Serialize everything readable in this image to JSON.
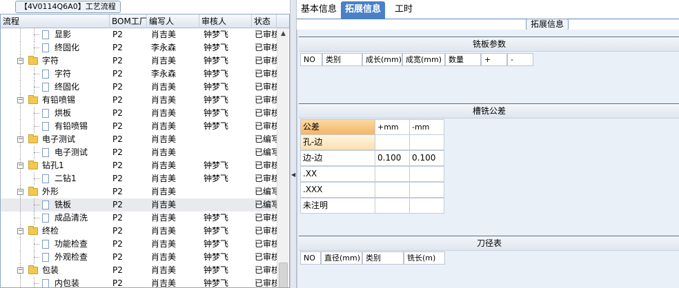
{
  "left_panel": {
    "title": "【4V0114Q6A0】工艺流程",
    "columns": [
      "流程",
      "BOM工厂",
      "编写人",
      "审核人",
      "状态"
    ],
    "rows": [
      {
        "name": "显影",
        "level": 1,
        "kind": "doc",
        "bom": "P2",
        "writer": "肖吉美",
        "reviewer": "钟梦飞",
        "status": "已审核"
      },
      {
        "name": "终固化",
        "level": 1,
        "kind": "doc",
        "bom": "P2",
        "writer": "李永森",
        "reviewer": "钟梦飞",
        "status": "已审核"
      },
      {
        "name": "字符",
        "level": 0,
        "kind": "folder",
        "bom": "P2",
        "writer": "肖吉美",
        "reviewer": "钟梦飞",
        "status": "已审核"
      },
      {
        "name": "字符",
        "level": 1,
        "kind": "doc",
        "bom": "P2",
        "writer": "李永森",
        "reviewer": "钟梦飞",
        "status": "已审核"
      },
      {
        "name": "终固化",
        "level": 1,
        "kind": "doc",
        "bom": "P2",
        "writer": "肖吉美",
        "reviewer": "钟梦飞",
        "status": "已审核"
      },
      {
        "name": "有铅喷锡",
        "level": 0,
        "kind": "folder",
        "bom": "P2",
        "writer": "肖吉美",
        "reviewer": "钟梦飞",
        "status": "已审核"
      },
      {
        "name": "烘板",
        "level": 1,
        "kind": "doc",
        "bom": "P2",
        "writer": "肖吉美",
        "reviewer": "钟梦飞",
        "status": "已审核"
      },
      {
        "name": "有铅喷锡",
        "level": 1,
        "kind": "doc",
        "bom": "P2",
        "writer": "肖吉美",
        "reviewer": "钟梦飞",
        "status": "已审核"
      },
      {
        "name": "电子测试",
        "level": 0,
        "kind": "folder",
        "bom": "P2",
        "writer": "肖吉美",
        "reviewer": "",
        "status": "已编写"
      },
      {
        "name": "电子测试",
        "level": 1,
        "kind": "doc",
        "bom": "P2",
        "writer": "肖吉美",
        "reviewer": "",
        "status": "已编写"
      },
      {
        "name": "钻孔1",
        "level": 0,
        "kind": "folder",
        "bom": "P2",
        "writer": "肖吉美",
        "reviewer": "钟梦飞",
        "status": "已审核"
      },
      {
        "name": "二钻1",
        "level": 1,
        "kind": "doc",
        "bom": "P2",
        "writer": "肖吉美",
        "reviewer": "钟梦飞",
        "status": "已审核"
      },
      {
        "name": "外形",
        "level": 0,
        "kind": "folder",
        "bom": "P2",
        "writer": "肖吉美",
        "reviewer": "",
        "status": "已编写"
      },
      {
        "name": "铣板",
        "level": 1,
        "kind": "doc",
        "bom": "P2",
        "writer": "肖吉美",
        "reviewer": "",
        "status": "已编写",
        "selected": true
      },
      {
        "name": "成品清洗",
        "level": 1,
        "kind": "doc",
        "bom": "P2",
        "writer": "肖吉美",
        "reviewer": "钟梦飞",
        "status": "已审核"
      },
      {
        "name": "终检",
        "level": 0,
        "kind": "folder",
        "bom": "P2",
        "writer": "肖吉美",
        "reviewer": "钟梦飞",
        "status": "已审核"
      },
      {
        "name": "功能检查",
        "level": 1,
        "kind": "doc",
        "bom": "P2",
        "writer": "肖吉美",
        "reviewer": "钟梦飞",
        "status": "已审核"
      },
      {
        "name": "外观检查",
        "level": 1,
        "kind": "doc",
        "bom": "P2",
        "writer": "肖吉美",
        "reviewer": "钟梦飞",
        "status": "已审核"
      },
      {
        "name": "包装",
        "level": 0,
        "kind": "folder",
        "bom": "P2",
        "writer": "肖吉美",
        "reviewer": "钟梦飞",
        "status": "已审核"
      },
      {
        "name": "内包装",
        "level": 1,
        "kind": "doc",
        "bom": "P2",
        "writer": "肖吉美",
        "reviewer": "钟梦飞",
        "status": "已审核"
      }
    ]
  },
  "right_panel": {
    "tabs": [
      "基本信息",
      "拓展信息",
      "工时"
    ],
    "active_tab": 1,
    "section_title": "拓展信息",
    "milling_params": {
      "title": "铣板参数",
      "columns": [
        "NO",
        "类别",
        "成长(mm)",
        "成宽(mm)",
        "数量",
        "+",
        "-"
      ]
    },
    "slot_tolerance": {
      "title": "槽铣公差",
      "columns": [
        "公差",
        "+mm",
        "-mm"
      ],
      "rows": [
        {
          "label": "孔-边",
          "plus": "",
          "minus": ""
        },
        {
          "label": "边-边",
          "plus": "0.100",
          "minus": "0.100"
        },
        {
          "label": ".XX",
          "plus": "",
          "minus": ""
        },
        {
          "label": ".XXX",
          "plus": "",
          "minus": ""
        },
        {
          "label": "未注明",
          "plus": "",
          "minus": ""
        }
      ]
    },
    "tool_diameter": {
      "title": "刀径表",
      "columns": [
        "NO",
        "直径(mm)",
        "类别",
        "铣长(m)"
      ]
    }
  },
  "colors": {
    "tab_active": "#4a80c8",
    "highlight_gold": "#f4b565",
    "folder": "#f2c94c"
  }
}
